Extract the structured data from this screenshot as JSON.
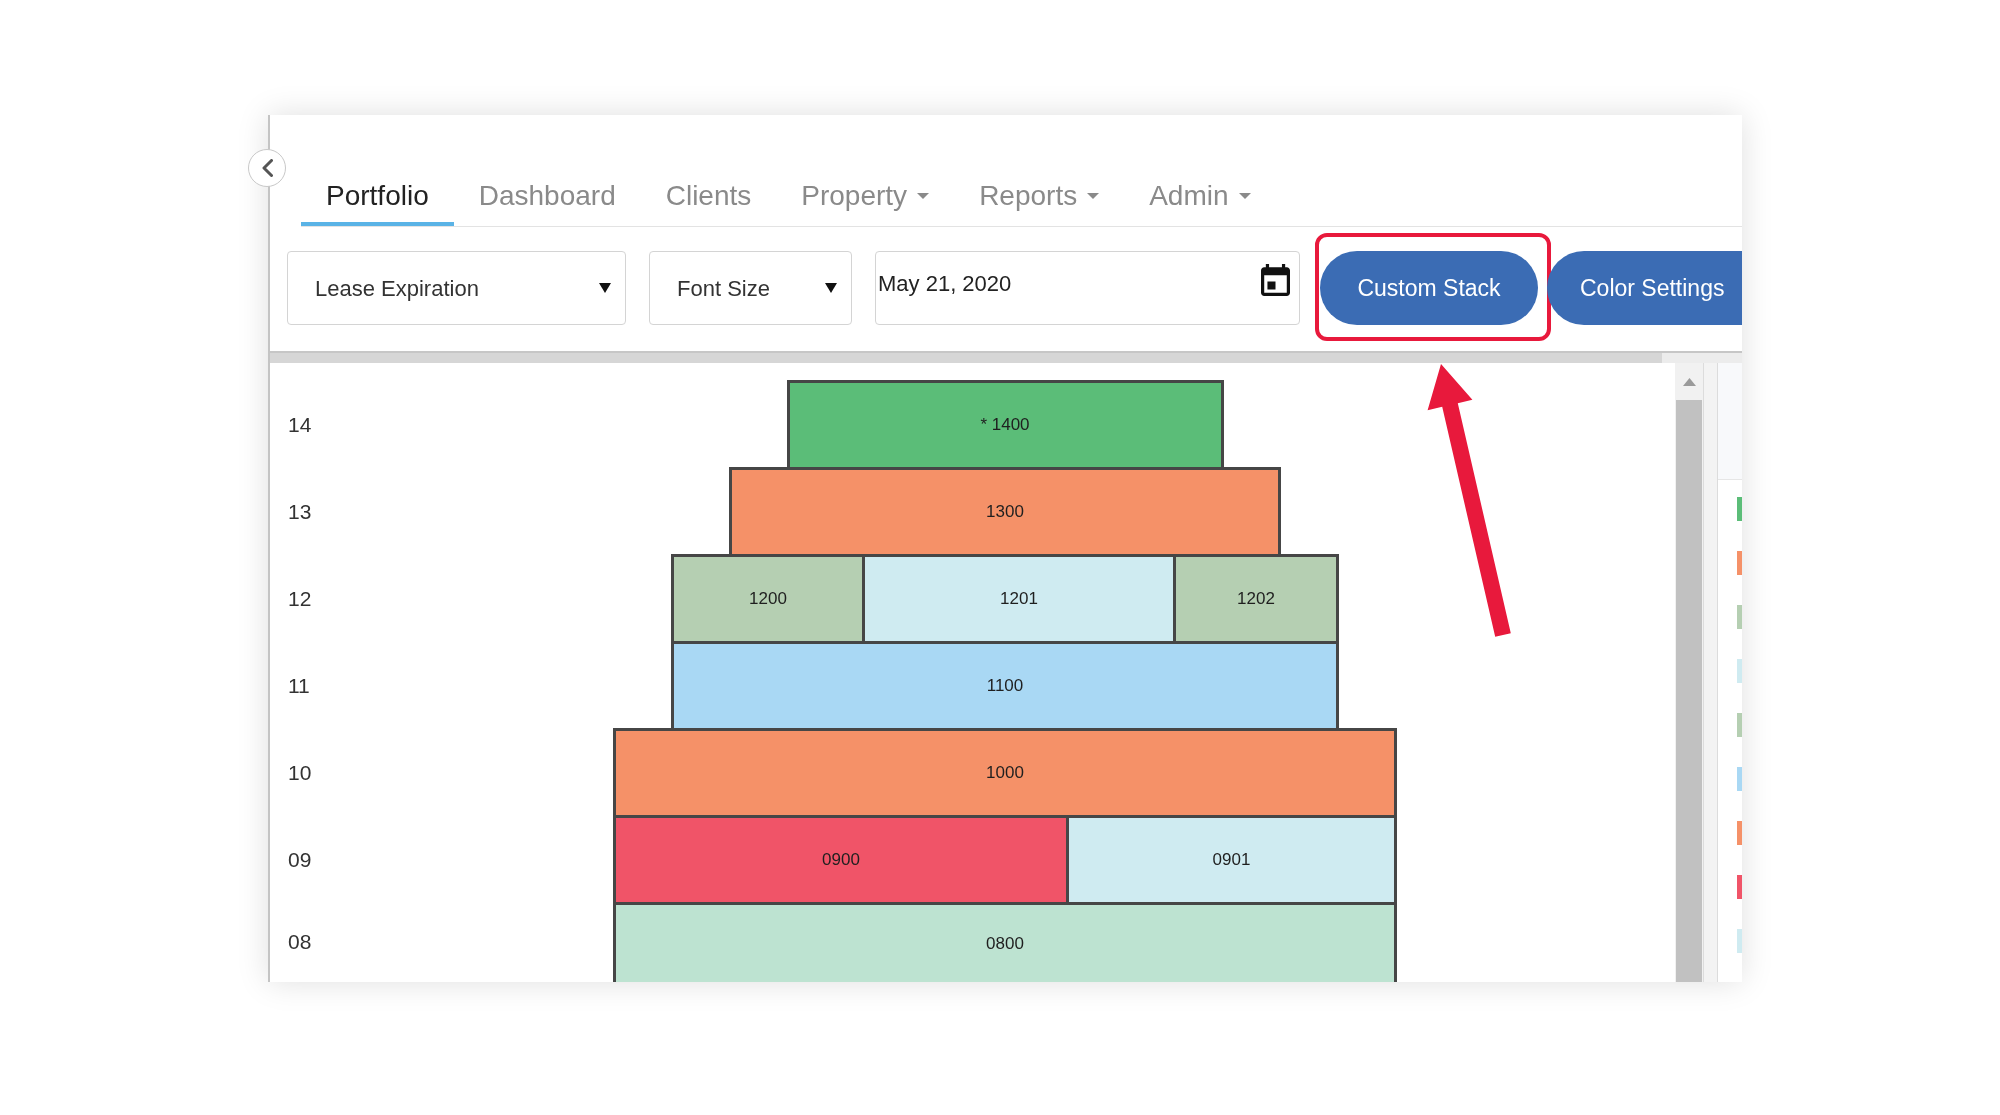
{
  "tabs": [
    {
      "label": "Portfolio",
      "selected": true,
      "dropdown": false
    },
    {
      "label": "Dashboard",
      "selected": false,
      "dropdown": false
    },
    {
      "label": "Clients",
      "selected": false,
      "dropdown": false
    },
    {
      "label": "Property",
      "selected": false,
      "dropdown": true
    },
    {
      "label": "Reports",
      "selected": false,
      "dropdown": true
    },
    {
      "label": "Admin",
      "selected": false,
      "dropdown": true
    }
  ],
  "toolbar": {
    "selects": [
      {
        "value": "Lease Expiration"
      },
      {
        "value": "Font Size"
      }
    ],
    "date_field": {
      "value": "May 21, 2020"
    },
    "buttons": [
      {
        "label": "Custom Stack",
        "highlighted": true
      },
      {
        "label": "Color Settings",
        "highlighted": false
      }
    ]
  },
  "stack_plan": {
    "floors": [
      {
        "label": "14",
        "units": [
          {
            "label": "* 1400",
            "color": "#5bbd78"
          }
        ]
      },
      {
        "label": "13",
        "units": [
          {
            "label": "1300",
            "color": "#f59168"
          }
        ]
      },
      {
        "label": "12",
        "units": [
          {
            "label": "1200",
            "color": "#b5cfb2"
          },
          {
            "label": "1201",
            "color": "#cfebf1"
          },
          {
            "label": "1202",
            "color": "#b5cfb2"
          }
        ]
      },
      {
        "label": "11",
        "units": [
          {
            "label": "1100",
            "color": "#a9d8f4"
          }
        ]
      },
      {
        "label": "10",
        "units": [
          {
            "label": "1000",
            "color": "#f59168"
          }
        ]
      },
      {
        "label": "09",
        "units": [
          {
            "label": "0900",
            "color": "#f05468"
          },
          {
            "label": "0901",
            "color": "#cfebf1"
          }
        ]
      },
      {
        "label": "08",
        "units": [
          {
            "label": "0800",
            "color": "#bde3d1"
          }
        ]
      }
    ]
  },
  "legend": {
    "swatches": [
      {
        "color": "#5bbd78"
      },
      {
        "color": "#f59168"
      },
      {
        "color": "#b5cfb2"
      },
      {
        "color": "#cfebf1"
      },
      {
        "color": "#b5cfb2"
      },
      {
        "color": "#a9d8f4"
      },
      {
        "color": "#f59168"
      },
      {
        "color": "#f05468"
      },
      {
        "color": "#cfebf1"
      }
    ]
  }
}
